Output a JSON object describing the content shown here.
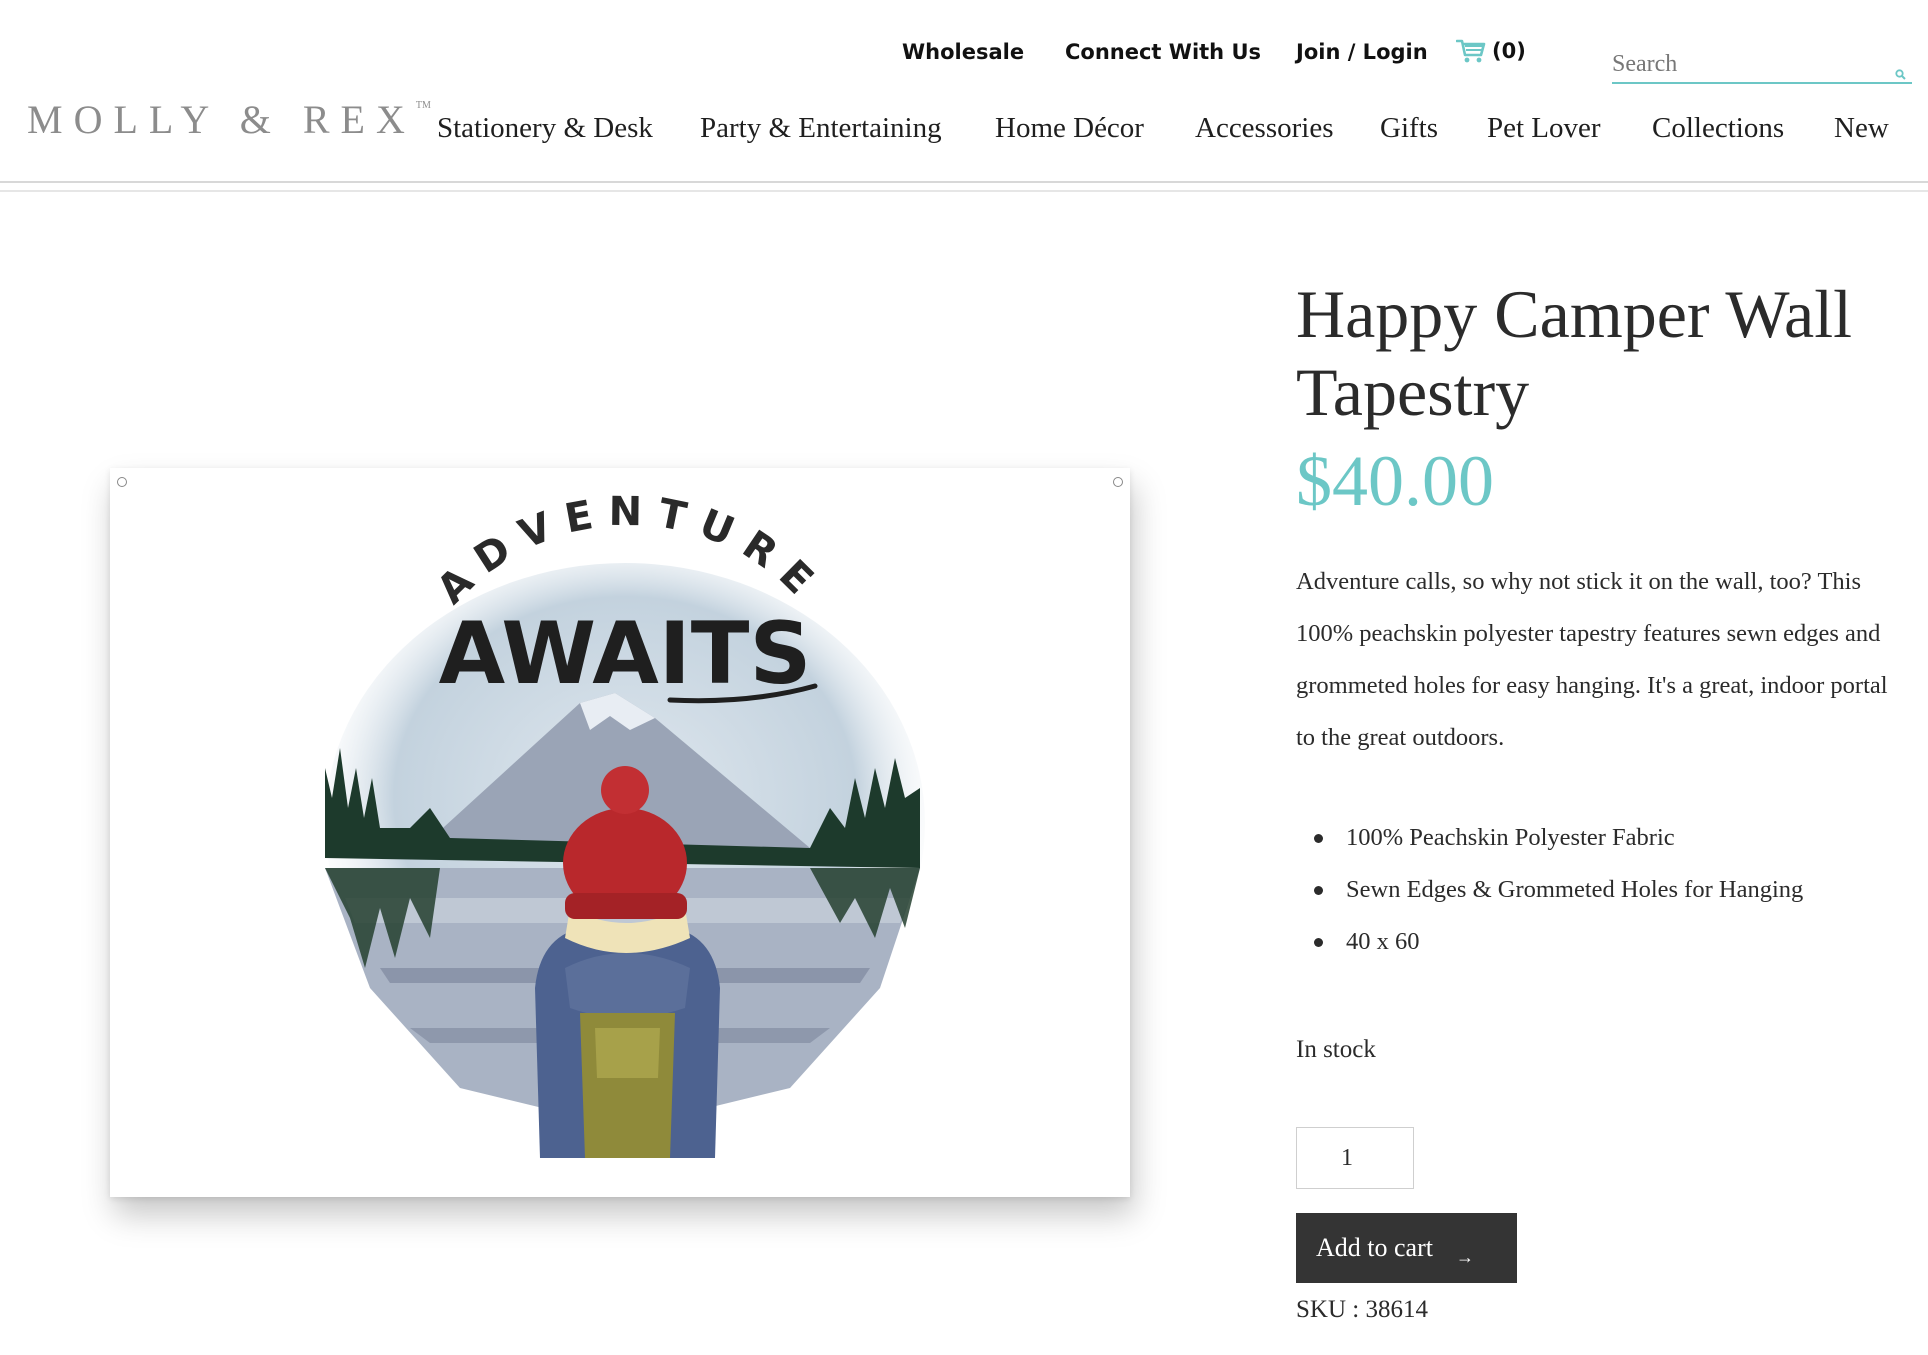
{
  "header": {
    "utility_nav": {
      "wholesale": "Wholesale",
      "connect": "Connect With Us",
      "login": "Join / Login",
      "cart_count": "(0)"
    },
    "search": {
      "placeholder": "Search"
    },
    "logo": {
      "text": "MOLLY & REX",
      "trademark": "TM"
    },
    "main_nav": [
      "Stationery & Desk",
      "Party & Entertaining",
      "Home Décor",
      "Accessories",
      "Gifts",
      "Pet Lover",
      "Collections",
      "New"
    ]
  },
  "product": {
    "image_text": {
      "arc": "ADVENTURE",
      "main": "AWAITS"
    },
    "title": "Happy Camper Wall Tapestry",
    "price": "$40.00",
    "description": "Adventure calls, so why not stick it on the wall, too? This 100% peachskin polyester tapestry features sewn edges and grommeted holes for easy hanging. It's a great, indoor portal to the great outdoors.",
    "features": [
      "100% Peachskin Polyester Fabric",
      "Sewn Edges & Grommeted Holes for Hanging",
      "40 x 60"
    ],
    "stock_status": "In stock",
    "quantity": "1",
    "add_to_cart_label": "Add to cart",
    "sku": "SKU : 38614"
  },
  "colors": {
    "accent": "#6cc7c6",
    "button": "#343434"
  }
}
